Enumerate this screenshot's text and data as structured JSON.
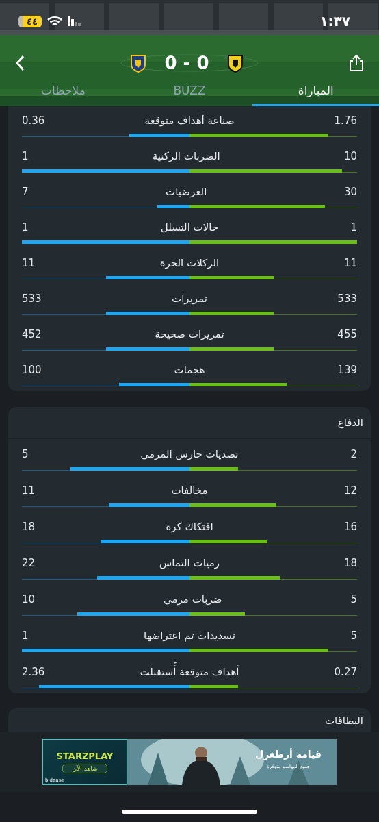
{
  "status_bar": {
    "time": "١:٣٧",
    "battery": "٤٤"
  },
  "match": {
    "score": "0 - 0"
  },
  "tabs": [
    {
      "label": "المباراة",
      "selected": true
    },
    {
      "label": "BUZZ",
      "selected": false
    },
    {
      "label": "ملاحظات",
      "selected": false
    }
  ],
  "sections": [
    {
      "rows": [
        {
          "label": "صناعة أهداف متوقعة",
          "home": {
            "value": "1.76",
            "level": 0.83
          },
          "away": {
            "value": "0.36",
            "level": 0.36
          }
        },
        {
          "label": "الضربات الركنية",
          "home": {
            "value": "10",
            "level": 0.91
          },
          "away": {
            "value": "1",
            "level": 1
          }
        },
        {
          "label": "العرضيات",
          "home": {
            "value": "30",
            "level": 0.81
          },
          "away": {
            "value": "7",
            "level": 0.19
          }
        },
        {
          "label": "حالات التسلل",
          "home": {
            "value": "1",
            "level": 1
          },
          "away": {
            "value": "1",
            "level": 1
          }
        },
        {
          "label": "الركلات الحرة",
          "home": {
            "value": "11",
            "level": 0.5
          },
          "away": {
            "value": "11",
            "level": 0.5
          }
        },
        {
          "label": "تمريرات",
          "home": {
            "value": "533",
            "level": 0.5
          },
          "away": {
            "value": "533",
            "level": 0.5
          }
        },
        {
          "label": "تمريرات صحيحة",
          "home": {
            "value": "455",
            "level": 0.5
          },
          "away": {
            "value": "452",
            "level": 0.5
          }
        },
        {
          "label": "هجمات",
          "home": {
            "value": "139",
            "level": 0.58
          },
          "away": {
            "value": "100",
            "level": 0.42
          }
        }
      ]
    },
    {
      "title": "الدفاع",
      "rows": [
        {
          "label": "تصديات حارس المرمى",
          "home": {
            "value": "2",
            "level": 0.29
          },
          "away": {
            "value": "5",
            "level": 0.71
          }
        },
        {
          "label": "مخالفات",
          "home": {
            "value": "12",
            "level": 0.52
          },
          "away": {
            "value": "11",
            "level": 0.48
          }
        },
        {
          "label": "افتكاك كرة",
          "home": {
            "value": "16",
            "level": 0.46
          },
          "away": {
            "value": "18",
            "level": 0.53
          }
        },
        {
          "label": "رميات التماس",
          "home": {
            "value": "18",
            "level": 0.54
          },
          "away": {
            "value": "22",
            "level": 0.55
          }
        },
        {
          "label": "ضربات مرمى",
          "home": {
            "value": "5",
            "level": 0.33
          },
          "away": {
            "value": "10",
            "level": 0.67
          }
        },
        {
          "label": "تسديدات تم اعتراضها",
          "home": {
            "value": "5",
            "level": 0.83
          },
          "away": {
            "value": "1",
            "level": 1
          }
        },
        {
          "label": "أهداف متوقعة أُستقبلت",
          "home": {
            "value": "0.27",
            "level": 0.29
          },
          "away": {
            "value": "2.36",
            "level": 0.9
          }
        }
      ]
    },
    {
      "title": "البطاقات"
    }
  ],
  "ad": {
    "brand": "STARZPLAY",
    "cta": "شاهد الآن",
    "network": "bidease",
    "headline": "قيامة أرطغرل",
    "subline": "جميع المواسم متوفرة"
  }
}
